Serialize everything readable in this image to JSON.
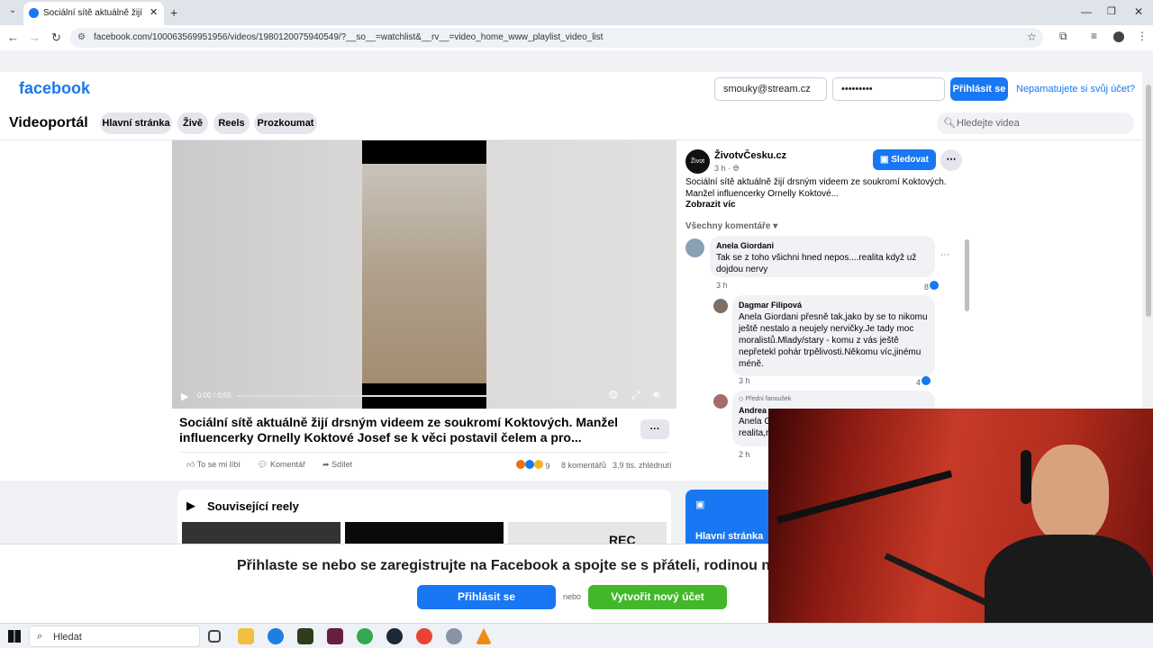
{
  "browser": {
    "tab_title": "Sociální sítě aktuálně žijí drsným",
    "url": "facebook.com/100063569951956/videos/1980120075940549/?__so__=watchlist&__rv__=video_home_www_playlist_video_list"
  },
  "header": {
    "logo": "facebook",
    "email_value": "smouky@stream.cz",
    "password_value": "•••••••••",
    "login_label": "Přihlásit se",
    "forgot_label": "Nepamatujete si svůj účet?"
  },
  "subnav": {
    "title": "Videoportál",
    "tabs": [
      "Hlavní stránka",
      "Živě",
      "Reels",
      "Prozkoumat"
    ],
    "search_placeholder": "Hledejte videa"
  },
  "video": {
    "time": "0:00 / 0:55",
    "title": "Sociální sítě aktuálně žijí drsným videem ze soukromí Koktových. Manžel influencerky Ornelly Koktové Josef se k věci postavil čelem a pro...",
    "like_label": "To se mi líbí",
    "comment_label": "Komentář",
    "share_label": "Sdílet",
    "reaction_count": "9",
    "comments_count": "8 komentářů",
    "views": "3,9 tis. zhlédnutí",
    "more_label": "···"
  },
  "post": {
    "page_name": "ŽivotvČesku.cz",
    "avatar_text": "Život",
    "time": "3 h",
    "follow_label": "Sledovat",
    "text": "Sociální sítě aktuálně žijí drsným videem ze soukromí Koktových. Manžel influencerky Ornelly Koktové...",
    "see_more": "Zobrazit víc",
    "all_comments": "Všechny komentáře"
  },
  "comments": [
    {
      "author": "Anela Giordani",
      "text": "Tak se z toho všichni hned nepos....realita když už dojdou nervy",
      "time": "3 h",
      "likes": "8"
    },
    {
      "author": "Dagmar Filipová",
      "text": "Anela Giordani přesně tak,jako by se to nikomu ještě nestalo a neujely nervičky.Je tady moc moralistů.Mlady/stary - komu z vás ještě nepřetekl pohár trpělivosti.Někomu víc,jinému méně.",
      "time": "3 h",
      "likes": "4"
    },
    {
      "badge": "Přední fanoušek",
      "author": "Andrea",
      "text": "Anela G",
      "text2": "realita,r",
      "time": "2 h"
    }
  ],
  "related": {
    "title": "Související reely",
    "rec_label": "REC"
  },
  "sidebar_card": {
    "label": "Hlavní stránka"
  },
  "banner": {
    "text": "Přihlaste se nebo se zaregistrujte na Facebook a spojte se s přáteli, rodinou neb",
    "login_label": "Přihlásit se",
    "or_label": "nebo",
    "signup_label": "Vytvořit nový účet"
  },
  "taskbar": {
    "search_label": "Hledat"
  }
}
